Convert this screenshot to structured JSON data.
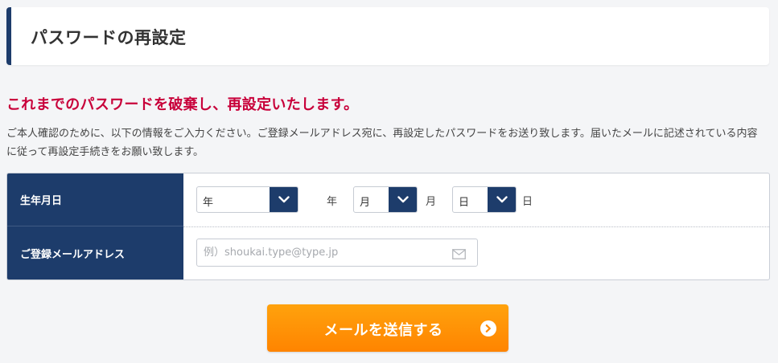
{
  "page": {
    "title": "パスワードの再設定",
    "headline": "これまでのパスワードを破棄し、再設定いたします。",
    "description": "ご本人確認のために、以下の情報をご入力ください。ご登録メールアドレス宛に、再設定したパスワードをお送り致します。届いたメールに記述されている内容に従って再設定手続きをお願い致します。"
  },
  "form": {
    "birthday": {
      "label": "生年月日",
      "year": {
        "selected": "年",
        "unit": "年"
      },
      "month": {
        "selected": "月",
        "unit": "月"
      },
      "day": {
        "selected": "日",
        "unit": "日"
      }
    },
    "email": {
      "label": "ご登録メールアドレス",
      "value": "",
      "placeholder": "例）shoukai.type@type.jp",
      "icon": "mail-icon"
    }
  },
  "submit": {
    "label": "メールを送信する",
    "icon": "chevron-right-circle-icon"
  },
  "colors": {
    "navy": "#1d3c6b",
    "headline_red": "#c8003a",
    "button_orange": "#ff9100",
    "background": "#f4f5f7"
  }
}
